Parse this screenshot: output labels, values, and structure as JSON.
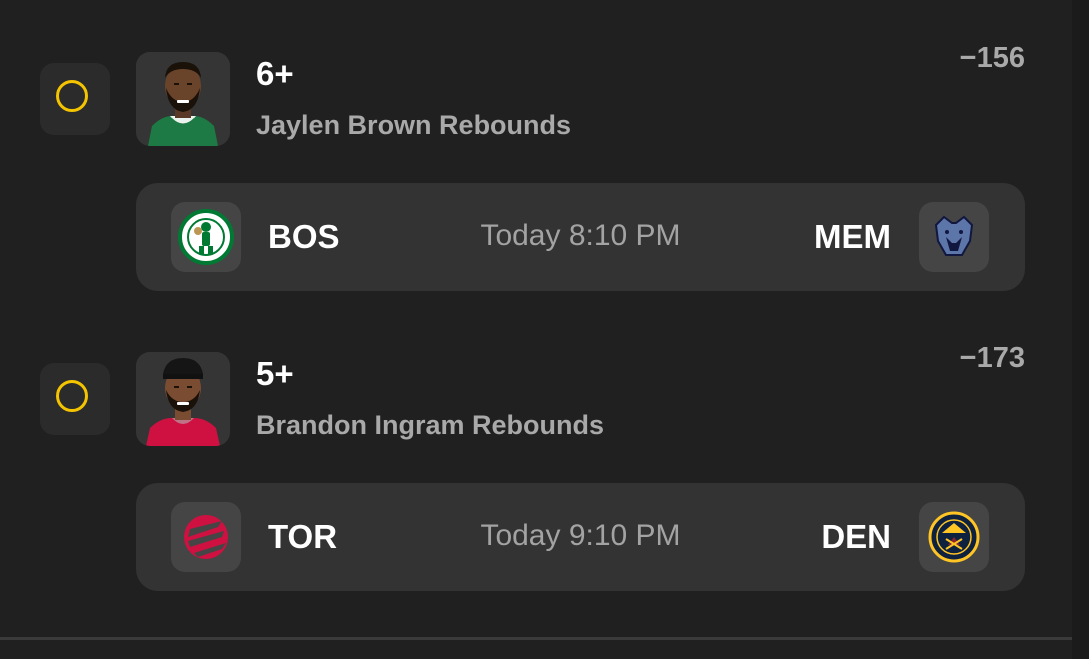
{
  "props": [
    {
      "line": "6+",
      "description": "Jaylen Brown Rebounds",
      "odds": "−156",
      "game": {
        "home_abbr": "BOS",
        "time": "Today 8:10 PM",
        "away_abbr": "MEM"
      }
    },
    {
      "line": "5+",
      "description": "Brandon Ingram Rebounds",
      "odds": "−173",
      "game": {
        "home_abbr": "TOR",
        "time": "Today 9:10 PM",
        "away_abbr": "DEN"
      }
    }
  ],
  "colors": {
    "background": "#202020",
    "card": "#333333",
    "radio_accent": "#f4c400",
    "muted_text": "#a9a9a9"
  },
  "icons": {
    "radio": "circle-outline",
    "avatars": [
      "player-headshot",
      "player-headshot"
    ],
    "team_logos": [
      "celtics-logo",
      "grizzlies-logo",
      "raptors-logo",
      "nuggets-logo"
    ]
  }
}
